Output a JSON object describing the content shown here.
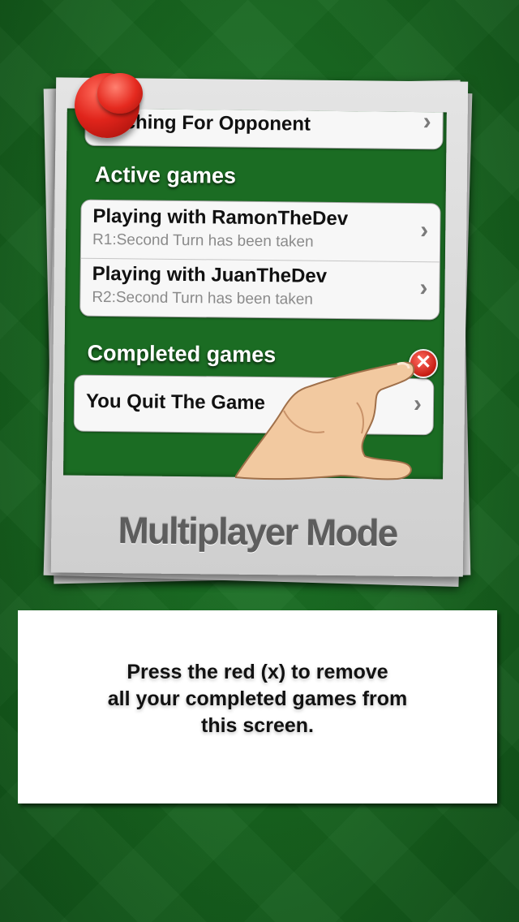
{
  "searching_row": {
    "title": "Searching For Opponent"
  },
  "sections": {
    "active": "Active games",
    "completed": "Completed games"
  },
  "active_games": [
    {
      "title": "Playing with RamonTheDev",
      "status": "R1:Second Turn has been taken"
    },
    {
      "title": "Playing with JuanTheDev",
      "status": "R2:Second Turn has been taken"
    }
  ],
  "completed_games": [
    {
      "title": "You Quit The Game"
    }
  ],
  "remove_button": {
    "glyph": "✕",
    "color": "#d4221a"
  },
  "chevron": "›",
  "footer_title": "Multiplayer Mode",
  "instructions": {
    "line1": "Press the red (x) to remove",
    "line2": "all your completed games from",
    "line3": "this screen."
  },
  "colors": {
    "table_green": "#17631f",
    "screen_green": "#1b6c23",
    "pin_red": "#e0241b"
  }
}
